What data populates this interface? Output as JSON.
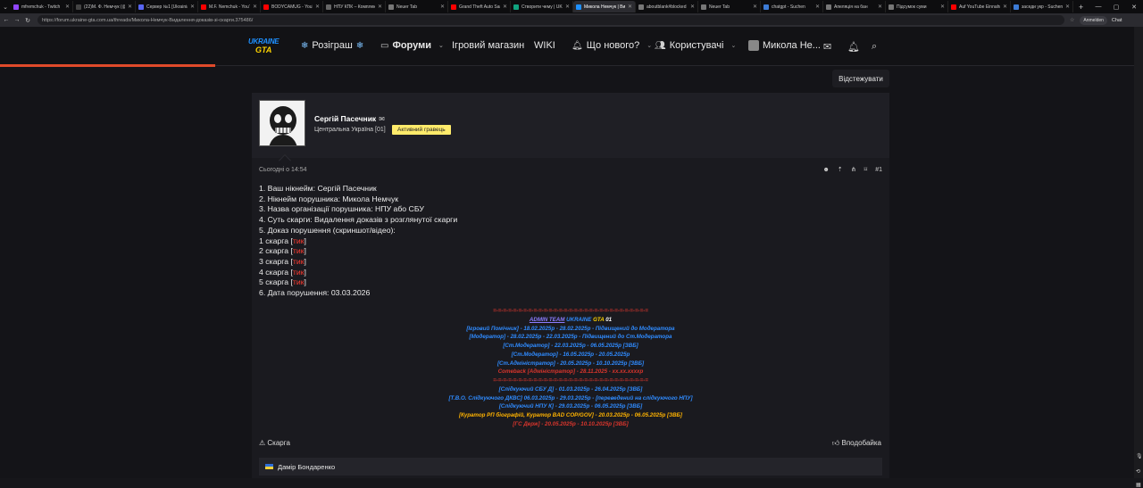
{
  "browser": {
    "tabs": [
      {
        "label": "mfremchuk - Twitch",
        "color": "#9146ff"
      },
      {
        "label": "(22)М. Ф. Немчук (@m...",
        "color": "#444444"
      },
      {
        "label": "Сервер №1 [Ukrainian...",
        "color": "#5865f2"
      },
      {
        "label": "M.F. Nemchuk - YouTube",
        "color": "#ff0000"
      },
      {
        "label": "BODYCAMUG - YouTube",
        "color": "#ff0000"
      },
      {
        "label": "НПУ КПК – Комплекс П...",
        "color": "#666666"
      },
      {
        "label": "Neuer Tab",
        "color": "#777777"
      },
      {
        "label": "Grand Theft Auto San A...",
        "color": "#ff0000"
      },
      {
        "label": "Створити чему | UKRAIN...",
        "color": "#10a37f"
      },
      {
        "label": "Микола Немчук | Вида...",
        "color": "#1e90ff"
      },
      {
        "label": "aboutblank#blocked",
        "color": "#777777"
      },
      {
        "label": "Neuer Tab",
        "color": "#777777"
      },
      {
        "label": "chatgpt - Suchen",
        "color": "#3c7bd6"
      },
      {
        "label": "Апеляція на бан",
        "color": "#777777"
      },
      {
        "label": "Підсумок суми",
        "color": "#777777"
      },
      {
        "label": "Auf YouTube Einnahmen...",
        "color": "#ff0000"
      },
      {
        "label": "заседи укр - Suchen",
        "color": "#3c7bd6"
      }
    ],
    "active_tab_index": 9,
    "new_tab": "+",
    "url": "https://forum.ukraine-gta.com.ua/threads/Микола-Немчук-Видалення-доказів-зі-скарги.375486/",
    "profile": "Anmelden",
    "chat": "Chat"
  },
  "site": {
    "logo_top": "UKRAINE",
    "logo_bottom": "GTA",
    "nav": {
      "giveaway": "Розіграш",
      "forums": "Форуми",
      "shop": "Ігровий магазин",
      "wiki": "WIKI",
      "whats_new": "Що нового?",
      "users": "Користувачі",
      "account": "Микола Не..."
    },
    "watch_button": "Відстежувати"
  },
  "post": {
    "author": "Сергій Пасечник",
    "region": "Центральна Україна [01]",
    "badge": "Активний гравець",
    "time": "Сьогодні о 14:54",
    "post_number": "#1",
    "lines": {
      "l1": "1. Ваш нікнейм: Сергій Пасечник",
      "l2": "2. Нікнейм порушника: Микола Немчук",
      "l3": "3. Назва організації порушника: НПУ або СБУ",
      "l4": "4. Суть скарги: Видалення доказів з розглянутої скарги",
      "l5": "5. Доказ порушення (скриншот/відео):",
      "c1": "1 скарга",
      "c2": "2 скарга",
      "c3": "3 скарга",
      "c4": "4 скарга",
      "c5": "5 скарга",
      "tick": "тик",
      "l6": "6. Дата порушення: 03.03.2026"
    },
    "signature": {
      "sep": "=-=-=-=-=-=-=-=-=-=-=-=-=-=-=-=-=-=-=-=-=-=-=-=-=-=-=-=-=-=-=",
      "admin_team": "ADMIN TEAM",
      "ukraine": "UKRAINE",
      "gta": "GTA",
      "num": "01",
      "s1": "[Ігровий Помічник] - 18.02.2025р - 28.02.2025р - Підвищений до Модератора",
      "s2": "[Модератор] - 28.02.2025р - 22.03.2025р - Підвищений до Ст.Модератора",
      "s3": "[Ст.Модератор] - 22.03.2025р - 06.05.2025р [ЗВБ]",
      "s4": "[Ст.Модератор] - 16.05.2025р - 20.05.2025р",
      "s5": "[Ст.Адміністратор] - 20.05.2025р - 10.10.2025р [ЗВБ]",
      "s6": "Comeback [Адміністратор] - 28.11.2025 - xx.xx.xxxxр",
      "s7": "[Слідкуючий СБУ Д] - 01.03.2025р - 26.04.2025р [ЗВБ]",
      "s8": "[Т.В.О. Слідкуючого ДКВС] 06.03.2025р - 29.03.2025р - [переведений на слідкуючого НПУ]",
      "s9": "[Слідкуючий НПУ К] - 29.03.2025р - 06.05.2025р [ЗВБ]",
      "s10": "[Куратор РП біографій, Куратор BAD COP/GOV] - 20.03.2025р - 06.05.2025р [ЗВБ]",
      "s11": "[ГС Держ] - 20.05.2025р - 10.10.2025р [ЗВБ]"
    },
    "report": "Скарга",
    "like": "Вподобайка",
    "reply_user": "Дамір Бондаренко"
  }
}
